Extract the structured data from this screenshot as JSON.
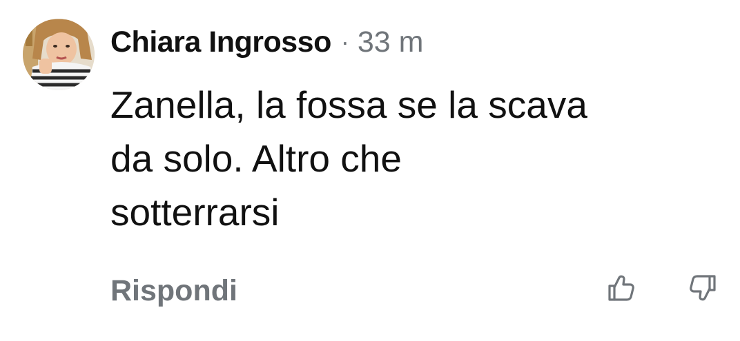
{
  "comment": {
    "author": "Chiara Ingrosso",
    "separator": "·",
    "time": "33 m",
    "text_lines": [
      "Zanella, la fossa se la scava",
      "da solo. Altro che",
      "sotterrarsi"
    ],
    "reply_label": "Rispondi"
  },
  "icons": {
    "avatar": "user-avatar-photo",
    "upvote": "thumbs-up-icon",
    "downvote": "thumbs-down-icon"
  },
  "colors": {
    "text": "#111111",
    "muted": "#70757a",
    "background": "#ffffff"
  }
}
